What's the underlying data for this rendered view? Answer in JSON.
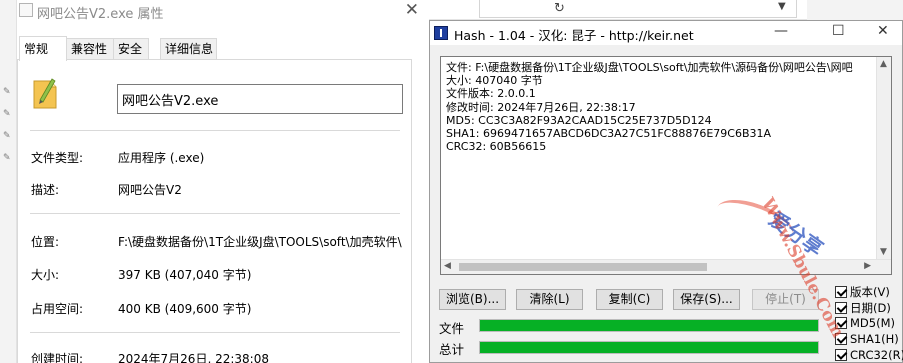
{
  "properties_window": {
    "title": "网吧公告V2.exe 属性",
    "tabs": [
      {
        "label": "常规",
        "active": true
      },
      {
        "label": "兼容性",
        "active": false
      },
      {
        "label": "安全",
        "active": false
      },
      {
        "label": "详细信息",
        "active": false
      }
    ],
    "filename": "网吧公告V2.exe",
    "rows": {
      "file_type": {
        "label": "文件类型:",
        "value": "应用程序 (.exe)"
      },
      "description": {
        "label": "描述:",
        "value": "网吧公告V2"
      },
      "location": {
        "label": "位置:",
        "value": "F:\\硬盘数据备份\\1T企业级J盘\\TOOLS\\soft\\加壳软件\\"
      },
      "size": {
        "label": "大小:",
        "value": "397 KB (407,040 字节)"
      },
      "size_on_disk": {
        "label": "占用空间:",
        "value": "400 KB (409,600 字节)"
      },
      "created": {
        "label": "创建时间:",
        "value": "2024年7月26日, 22:38:08"
      }
    }
  },
  "hash_window": {
    "title": "Hash - 1.04 - 汉化: 昆子 - http://keir.net",
    "output_lines": [
      "文件: F:\\硬盘数据备份\\1T企业级J盘\\TOOLS\\soft\\加壳软件\\源码备份\\网吧公告\\网吧",
      "大小: 407040 字节",
      "文件版本: 2.0.0.1",
      "修改时间: 2024年7月26日, 22:38:17",
      "MD5: CC3C3A82F93A2CAAD15C25E737D5D124",
      "SHA1: 6969471657ABCD6DC3A27C51FC88876E79C6B31A",
      "CRC32: 60B56615"
    ],
    "buttons": {
      "browse": "浏览(B)...",
      "clear": "清除(L)",
      "copy": "复制(C)",
      "save": "保存(S)...",
      "stop": "停止(T)"
    },
    "progress": {
      "file_label": "文件",
      "file_value": 1.0,
      "total_label": "总计",
      "total_value": 1.0,
      "color": "#06b025"
    },
    "options": [
      {
        "label": "版本(V)",
        "checked": true
      },
      {
        "label": "日期(D)",
        "checked": true
      },
      {
        "label": "MD5(M)",
        "checked": true
      },
      {
        "label": "SHA1(H)",
        "checked": true
      },
      {
        "label": "CRC32(R)",
        "checked": true
      }
    ]
  },
  "watermark": {
    "main": "爱分享",
    "url": "Www.Sbule.Com"
  }
}
